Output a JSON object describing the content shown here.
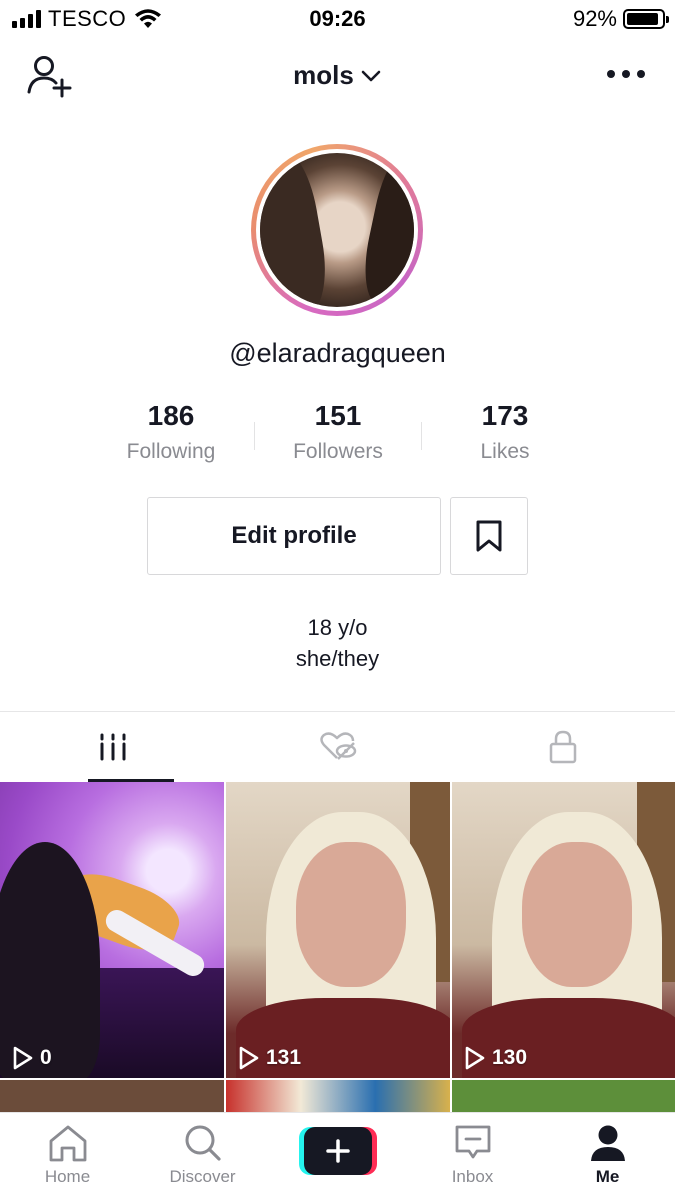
{
  "status_bar": {
    "carrier": "TESCO",
    "time": "09:26",
    "battery_percent": "92%",
    "battery_level": 0.92
  },
  "header": {
    "title": "mols",
    "icons": [
      "add-user-icon",
      "chevron-down-icon",
      "more-icon"
    ]
  },
  "profile": {
    "handle": "@elaradragqueen",
    "stats": [
      {
        "value": "186",
        "label": "Following"
      },
      {
        "value": "151",
        "label": "Followers"
      },
      {
        "value": "173",
        "label": "Likes"
      }
    ],
    "edit_label": "Edit profile",
    "bio_line1": "18 y/o",
    "bio_line2": "she/they"
  },
  "tabs": {
    "items": [
      "videos-grid-icon",
      "liked-hidden-icon",
      "lock-icon"
    ],
    "active": 0
  },
  "videos": [
    {
      "views": "0"
    },
    {
      "views": "131"
    },
    {
      "views": "130"
    }
  ],
  "bottom_nav": {
    "items": [
      {
        "label": "Home",
        "icon": "home-icon"
      },
      {
        "label": "Discover",
        "icon": "search-icon"
      },
      {
        "label": "",
        "icon": "create-plus-icon"
      },
      {
        "label": "Inbox",
        "icon": "inbox-icon"
      },
      {
        "label": "Me",
        "icon": "profile-icon"
      }
    ],
    "active": 4
  },
  "colors": {
    "text": "#161823",
    "secondary": "#8a8b91",
    "accent_cyan": "#25f4ee",
    "accent_red": "#fe2c55"
  }
}
